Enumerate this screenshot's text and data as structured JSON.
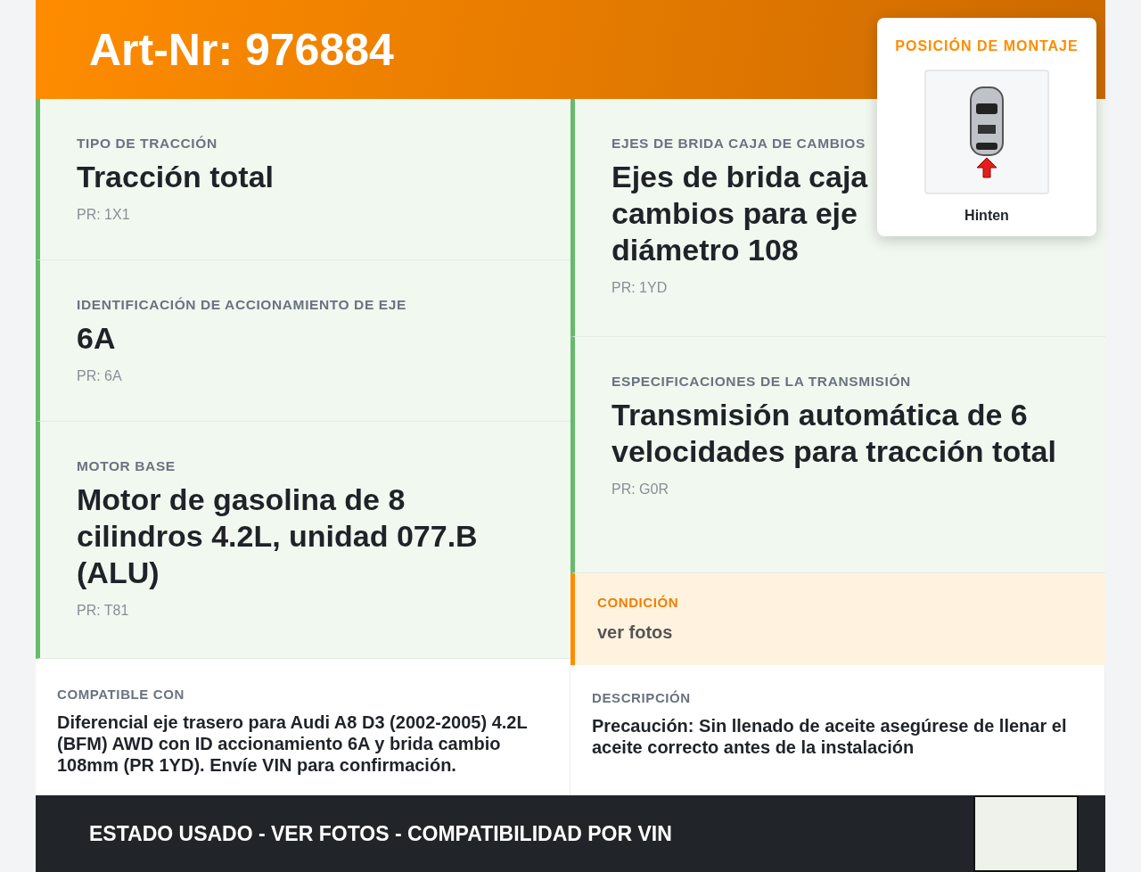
{
  "header": {
    "title": "Art-Nr: 976884"
  },
  "mounting_position": {
    "heading": "POSICIÓN DE MONTAJE",
    "caption": "Hinten"
  },
  "left_specs": [
    {
      "label": "TIPO DE TRACCIÓN",
      "value": "Tracción total",
      "code": "PR: 1X1"
    },
    {
      "label": "IDENTIFICACIÓN DE ACCIONAMIENTO DE EJE",
      "value": "6A",
      "code": "PR: 6A"
    },
    {
      "label": "MOTOR BASE",
      "value": "Motor de gasolina de 8 cilindros 4.2L, unidad 077.B (ALU)",
      "code": "PR: T81"
    }
  ],
  "right_specs": [
    {
      "label": "EJES DE BRIDA CAJA DE CAMBIOS",
      "value": "Ejes de brida caja cambios para eje diámetro 108",
      "code": "PR: 1YD",
      "kind": "narrow"
    },
    {
      "label": "ESPECIFICACIONES DE LA TRANSMISIÓN",
      "value": "Transmisión automática de 6 velocidades para tracción total",
      "code": "PR: G0R",
      "kind": "wide"
    }
  ],
  "condition": {
    "label": "CONDICIÓN",
    "value": "ver fotos"
  },
  "compatible": {
    "label": "COMPATIBLE CON",
    "text": "Diferencial eje trasero para Audi A8 D3 (2002-2005) 4.2L (BFM) AWD con ID accionamiento 6A y brida cambio 108mm (PR 1YD). Envíe VIN para confirmación."
  },
  "description": {
    "label": "DESCRIPCIÓN",
    "text": "Precaución: Sin llenado de aceite asegúrese de llenar el aceite correcto antes de la instalación"
  },
  "footer": {
    "text": "ESTADO USADO - VER FOTOS - COMPATIBILIDAD POR VIN"
  }
}
